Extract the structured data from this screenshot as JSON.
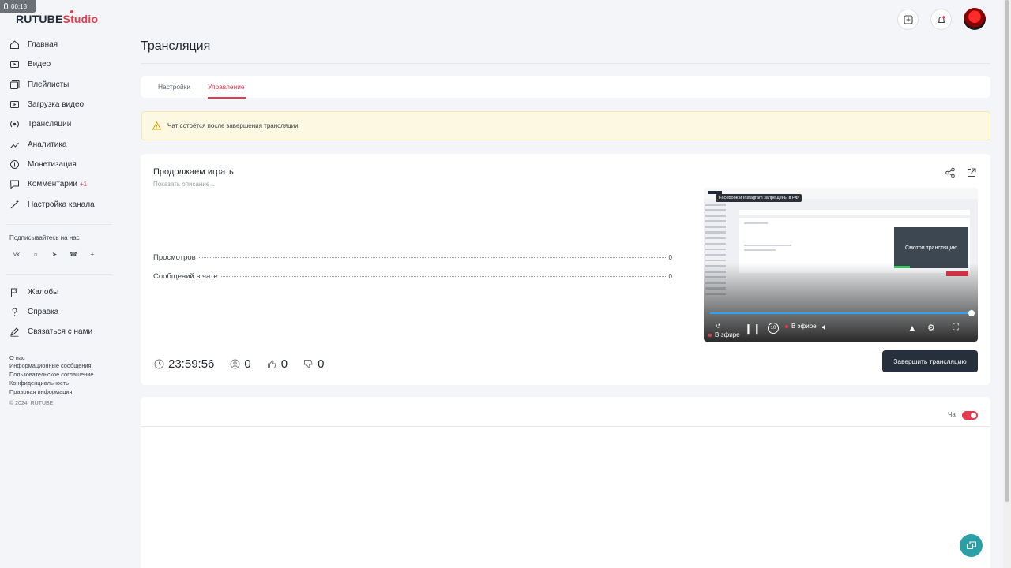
{
  "recording": {
    "time": "00:18"
  },
  "header": {
    "logo_main": "RUTUBE",
    "logo_studio": "Studio"
  },
  "sidebar": {
    "items": [
      {
        "label": "Главная",
        "icon": "home-icon"
      },
      {
        "label": "Видео",
        "icon": "video-icon"
      },
      {
        "label": "Плейлисты",
        "icon": "playlist-icon"
      },
      {
        "label": "Загрузка видео",
        "icon": "upload-icon"
      },
      {
        "label": "Трансляции",
        "icon": "broadcast-icon"
      },
      {
        "label": "Аналитика",
        "icon": "analytics-icon"
      },
      {
        "label": "Монетизация",
        "icon": "coin-icon"
      },
      {
        "label": "Комментарии",
        "icon": "comments-icon",
        "badge": "+1"
      },
      {
        "label": "Настройка канала",
        "icon": "magic-wand-icon"
      }
    ],
    "subscribe_label": "Подписывайтесь на нас",
    "socials": [
      "vk-icon",
      "ok-icon",
      "telegram-icon",
      "viber-icon",
      "plus-icon"
    ],
    "help_items": [
      {
        "label": "Жалобы",
        "icon": "flag-icon"
      },
      {
        "label": "Справка",
        "icon": "question-icon"
      },
      {
        "label": "Связаться с нами",
        "icon": "pen-icon"
      }
    ],
    "footer_links": [
      "О нас",
      "Информационные сообщения",
      "Пользовательское соглашение",
      "Конфиденциальность",
      "Правовая информация"
    ],
    "copyright": "© 2024, RUTUBE"
  },
  "main": {
    "title": "Трансляция",
    "tabs": [
      "Настройки",
      "Управление"
    ],
    "active_tab": "Управление",
    "notice": "Чат сотрётся после завершения трансляции",
    "stream": {
      "title": "Продолжаем играть",
      "show_description": "Показать описание",
      "stats": [
        {
          "label": "Просмотров",
          "value": "0"
        },
        {
          "label": "Сообщений в чате",
          "value": "0"
        }
      ],
      "metrics": {
        "duration": "23:59:56",
        "viewers": "0",
        "likes": "0",
        "dislikes": "0"
      },
      "end_button": "Завершить трансляцию"
    },
    "video": {
      "tooltip": "Facebook и Instagram запрещены в РФ",
      "popup_text": "Смотри трансляцию",
      "live_label_1": "В эфире",
      "live_label_2": "В эфире",
      "skip_label": "10"
    },
    "chat": {
      "label": "Чат",
      "enabled": true
    }
  },
  "colors": {
    "accent": "#e8384b",
    "dark_button": "#26303c",
    "notice_bg": "#fdf8e1",
    "fab": "#2b9fa6"
  }
}
